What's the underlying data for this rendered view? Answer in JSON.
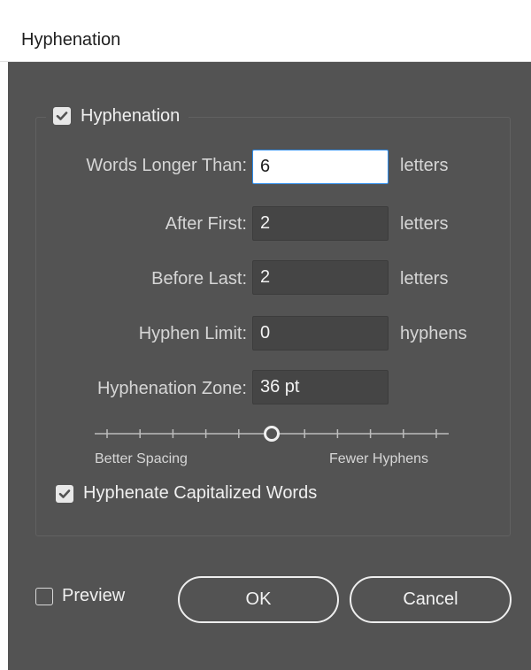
{
  "window": {
    "title": "Hyphenation"
  },
  "group": {
    "checkbox_label": "Hyphenation",
    "checked": true
  },
  "rows": {
    "words_longer_than": {
      "label": "Words Longer Than:",
      "value": "6",
      "unit": "letters"
    },
    "after_first": {
      "label": "After First:",
      "value": "2",
      "unit": "letters"
    },
    "before_last": {
      "label": "Before Last:",
      "value": "2",
      "unit": "letters"
    },
    "hyphen_limit": {
      "label": "Hyphen Limit:",
      "value": "0",
      "unit": "hyphens"
    },
    "hyphenation_zone": {
      "label": "Hyphenation Zone:",
      "value": "36 pt"
    }
  },
  "slider": {
    "left_label": "Better Spacing",
    "right_label": "Fewer Hyphens",
    "position": 0.5,
    "ticks": 11
  },
  "hyphenate_capitalized": {
    "label": "Hyphenate Capitalized Words",
    "checked": true
  },
  "preview": {
    "label": "Preview",
    "checked": false
  },
  "buttons": {
    "ok": "OK",
    "cancel": "Cancel"
  },
  "colors": {
    "dialog_bg": "#535353",
    "field_bg": "#454545",
    "focus_border": "#2d8ceb"
  },
  "icons": {
    "checked": "checkmark-icon"
  }
}
